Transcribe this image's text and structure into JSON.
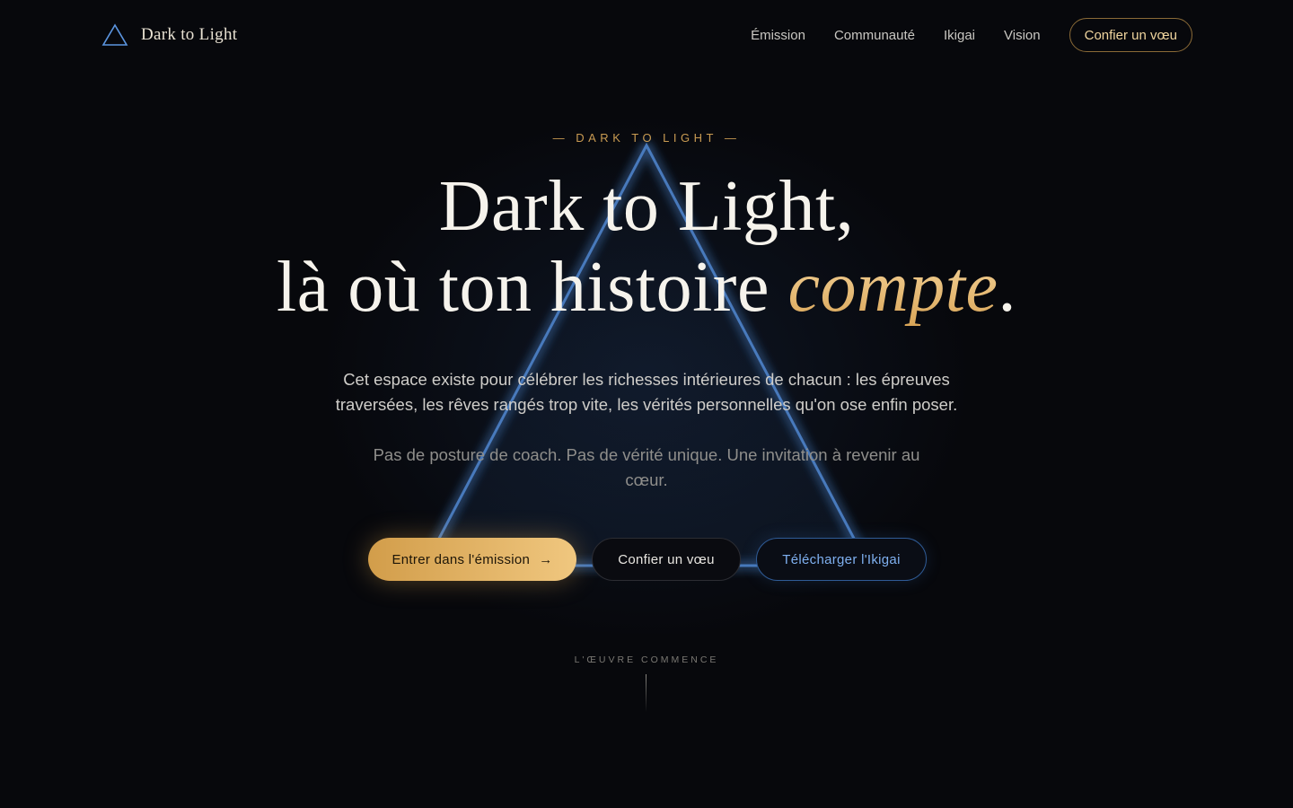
{
  "header": {
    "logo_text": "Dark to Light",
    "nav": [
      "Émission",
      "Communauté",
      "Ikigai",
      "Vision"
    ],
    "cta_label": "Confier un vœu"
  },
  "hero": {
    "eyebrow": "— DARK TO LIGHT —",
    "title_line1": "Dark to Light,",
    "title_line2_prefix": "là où ton histoire ",
    "title_accent": "compte",
    "title_suffix": ".",
    "lead": "Cet espace existe pour célébrer les richesses intérieures de chacun : les épreuves traversées, les rêves rangés trop vite, les vérités personnelles qu'on ose enfin poser.",
    "sub": "Pas de posture de coach. Pas de vérité unique. Une invitation à revenir au cœur.",
    "buttons": {
      "primary": "Entrer dans l'émission",
      "primary_icon": "arrow-right-icon",
      "secondary": "Confier un vœu",
      "tertiary": "Télécharger l'Ikigai"
    },
    "scroll_label": "L'ŒUVRE COMMENCE"
  },
  "colors": {
    "background": "#07080c",
    "accent_gold": "#d9a557",
    "accent_blue": "#4f86cf",
    "text": "#f6f3ec"
  }
}
